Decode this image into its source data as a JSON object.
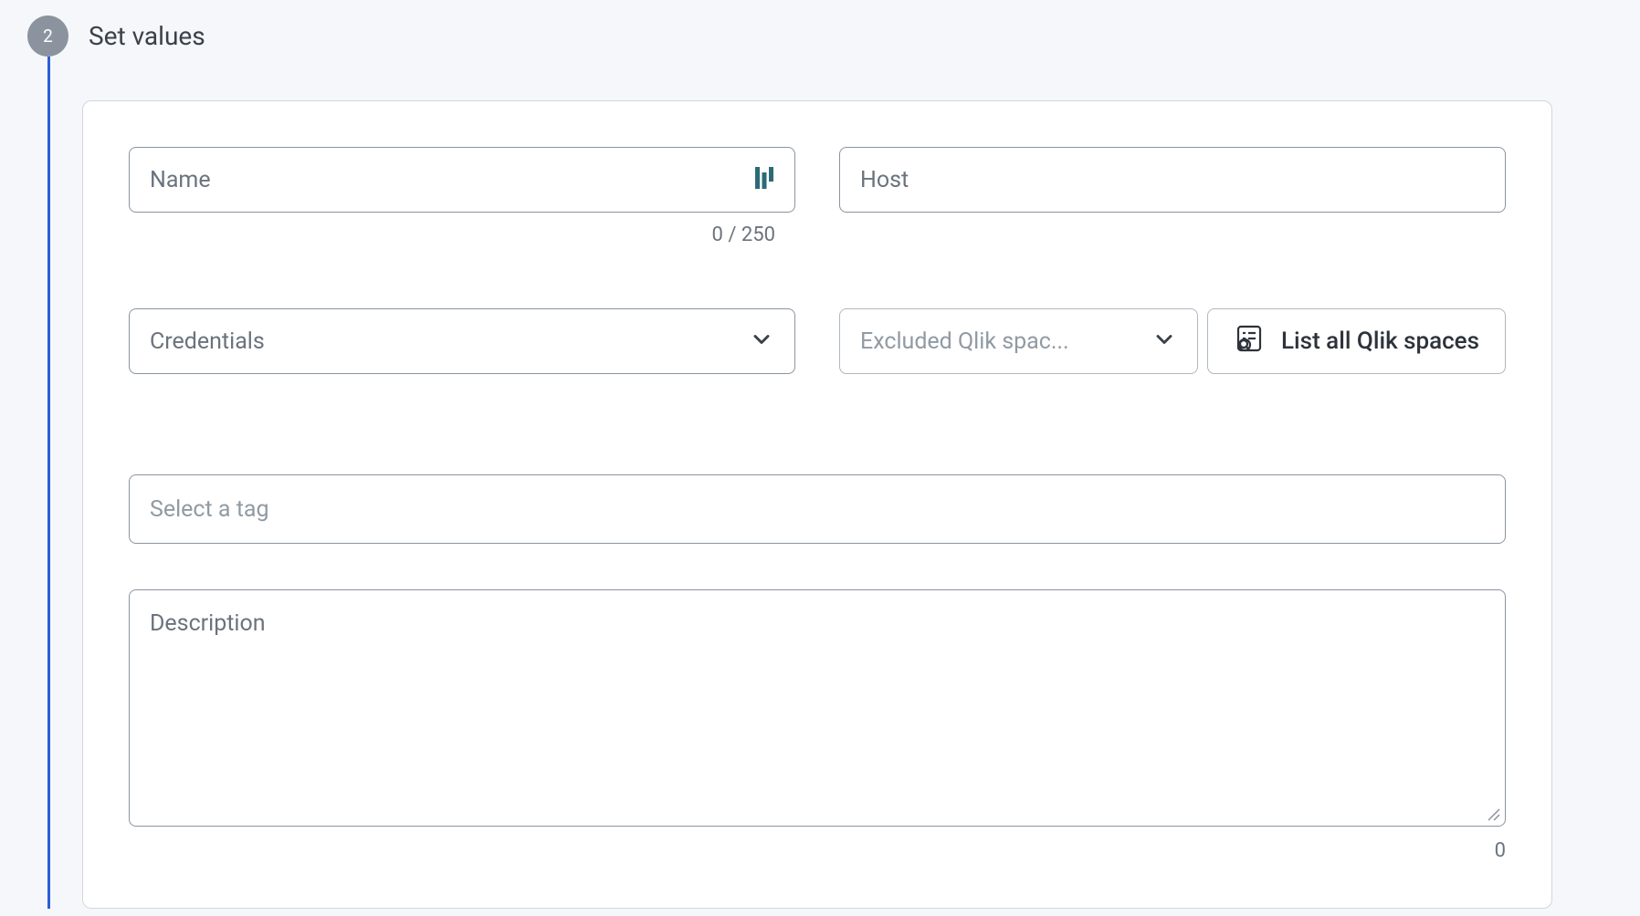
{
  "step": {
    "number": "2",
    "title": "Set values"
  },
  "form": {
    "name": {
      "placeholder": "Name",
      "counter": "0 / 250"
    },
    "host": {
      "placeholder": "Host"
    },
    "credentials": {
      "placeholder": "Credentials"
    },
    "excluded_spaces": {
      "placeholder": "Excluded Qlik spac..."
    },
    "list_button": {
      "label": "List all Qlik spaces"
    },
    "tag": {
      "placeholder": "Select a tag"
    },
    "description": {
      "placeholder": "Description",
      "counter": "0"
    }
  }
}
